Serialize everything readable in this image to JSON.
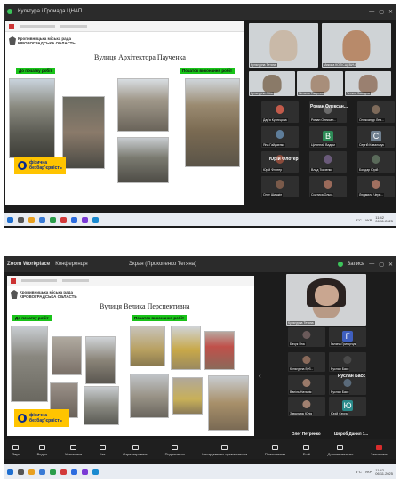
{
  "shot1": {
    "topbar": {
      "tab_label": "Культура і Громада ЦНАП",
      "zoom_hint": "",
      "controls": [
        "—",
        "▢",
        "✕"
      ]
    },
    "slide": {
      "org_line1": "Кропивницька міська рада",
      "org_line2": "КІРОВОГРАДСЬКА ОБЛАСТЬ",
      "title": "Вулиця Архітектора Паученка",
      "tag_before": "До початку робіт",
      "tag_after": "Початок виконання робіт",
      "badge_line1": "фізична",
      "badge_line2": "безбар'єрність"
    },
    "participants": [
      {
        "name": "Культурна Тетяна",
        "kind": "video",
        "color": "#c9b9a8"
      },
      {
        "name": "Микола КОЛІСЦЕВИЧ",
        "kind": "video",
        "color": "#b88a6a"
      },
      {
        "name": "Культурна ЗОШ",
        "kind": "video",
        "color": "#8a7a68"
      },
      {
        "name": "Наталія Тищенко",
        "kind": "video",
        "color": "#a88e7a"
      },
      {
        "name": "Тетяна Заводна",
        "kind": "video",
        "color": "#9a8070"
      },
      {
        "name": "Дар'я Кузнєцова",
        "kind": "avatar",
        "color": "#c25a4a"
      },
      {
        "name": "Роман Олексан...",
        "kind": "avatar",
        "color": "#6b6b6b"
      },
      {
        "name": "Олександр Лев...",
        "kind": "avatar",
        "color": "#7d6a5a"
      },
      {
        "name": "Яна Гайдаєнко",
        "kind": "avatar",
        "color": "#5e7d9a"
      },
      {
        "name": "Цілинний Вадим",
        "kind": "letter",
        "letter": "В",
        "color": "#2e8b57"
      },
      {
        "name": "Сергій Ковальчук",
        "kind": "letter",
        "letter": "С",
        "color": "#708090"
      },
      {
        "name": "Юрій Флотер",
        "kind": "avatar",
        "color": "#8b4a3a"
      },
      {
        "name": "Влад Ткаченко",
        "kind": "avatar",
        "color": "#6a5a7a"
      },
      {
        "name": "Бондар Юрій",
        "kind": "avatar",
        "color": "#5a6a5a"
      },
      {
        "name": "Олег Шишкін",
        "kind": "avatar",
        "color": "#7a5a4a"
      },
      {
        "name": "Солтиса Ольга",
        "kind": "avatar",
        "color": "#9a6a5a"
      },
      {
        "name": "Людмила Черн...",
        "kind": "avatar",
        "color": "#a07060"
      }
    ],
    "names_bold": [
      "Роман Олексан...",
      "Юрій Флотер"
    ],
    "taskbar": {
      "temp": "8°C",
      "lang": "УКР",
      "time": "11:42",
      "date": "06.11.2025"
    }
  },
  "shot2": {
    "topbar": {
      "app": "Zoom Workplace",
      "conference": "Конференція",
      "speaker": "Экран (Прокопенко Тетяна)",
      "record": "Запись",
      "controls": [
        "—",
        "▢",
        "✕"
      ]
    },
    "slide": {
      "org_line1": "Кропивницька міська рада",
      "org_line2": "КІРОВОГРАДСЬКА ОБЛАСТЬ",
      "title": "Вулиця Велика Перспективна",
      "tag_before": "До початку робіт",
      "tag_after": "Початок виконання робіт",
      "badge_line1": "фізична",
      "badge_line2": "безбар'єрність"
    },
    "speaker_name": "Культурна Тетяна",
    "participants": [
      {
        "name": "Бачук Яна",
        "kind": "avatar",
        "color": "#6a5a5a"
      },
      {
        "name": "Галина Григорчук",
        "kind": "letter",
        "letter": "Г",
        "color": "#3f5fbf"
      },
      {
        "name": "Культурна Буб...",
        "kind": "avatar",
        "color": "#8a6a5a"
      },
      {
        "name": "Руслан Басс",
        "kind": "avatar",
        "color": "#4a4a4a"
      },
      {
        "name": "Ваніль Наталія",
        "kind": "avatar",
        "color": "#9a7a6a"
      },
      {
        "name": "Руслан Басс",
        "kind": "avatar",
        "color": "#5a6a7a"
      },
      {
        "name": "Завалдюк Юлія",
        "kind": "avatar",
        "color": "#a08070"
      },
      {
        "name": "Юрій Серга",
        "kind": "letter",
        "letter": "Ю",
        "color": "#2a8a8a"
      }
    ],
    "pname_mid": "Руслан Басс",
    "bottom_names": [
      "Олег Петренко",
      "Шероб Данил 1..."
    ],
    "toolbar": [
      "Звук",
      "Видео",
      "Участники",
      "Чат",
      "Отреагировать",
      "Поделиться",
      "Инструменты организатора",
      "Приложения",
      "Ещё",
      "Дополнительно",
      "Закончить"
    ],
    "taskbar": {
      "temp": "8°C",
      "lang": "УКР",
      "time": "11:42",
      "date": "06.11.2025"
    }
  }
}
